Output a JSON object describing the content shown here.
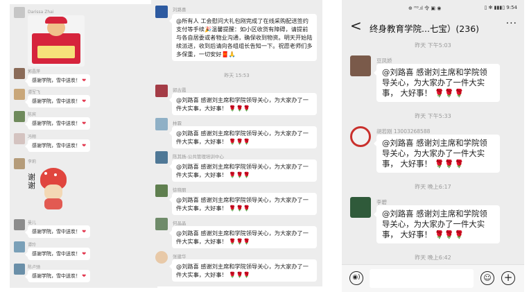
{
  "panel1": {
    "top_name": "Darissa Zhai",
    "messages": [
      {
        "name": "郭晶萍",
        "text": "感谢学院，雪中送炭！"
      },
      {
        "name": "谭军飞",
        "text": "感谢学院，雪中送炭！"
      },
      {
        "name": "陈宾",
        "text": "感谢学院，雪中送炭！"
      },
      {
        "name": "冯翔",
        "text": "感谢学院，雪中送炭！"
      },
      {
        "name": "李莉",
        "sticker": "谢谢"
      },
      {
        "name": "曼儿",
        "text": "感谢学院，雪中送炭！"
      },
      {
        "name": "谭玲",
        "text": "感谢学院，雪中送炭！"
      },
      {
        "name": "陈卢驰",
        "text": "感谢学院，雪中送炭！"
      }
    ],
    "heart": "❤"
  },
  "panel2": {
    "first": {
      "name": "刘路喜",
      "text": "@所有人 工会慰问大礼包刚完成了在线采购配送签约支付等手续🎉温馨提醒：如小区收货有障碍，请提前与各自居委或者物业沟通，确保收到物资。明天开始陆续派送，收到后请向各组组长告知一下。祝愿老师们多多保重，一切安好🧧🙏"
    },
    "timestamp": "昨天 15:53",
    "messages": [
      {
        "name": "郭古霞",
        "text": "@刘路喜 感谢刘主席和学院领导关心，为大家办了一件大实事，大好事！ 🌹🌹🌹"
      },
      {
        "name": "林霖",
        "text": "@刘路喜 感谢刘主席和学院领导关心，为大家办了一件大实事，大好事！ 🌹🌹🌹"
      },
      {
        "name": "陈其扬-公共管理培训中心",
        "text": "@刘路喜 感谢刘主席和学院领导关心，为大家办了一件大实事，大好事！ 🌹🌹🌹"
      },
      {
        "name": "徐晓丽",
        "text": "@刘路喜 感谢刘主席和学院领导关心，为大家办了一件大实事，大好事！ 🌹🌹🌹"
      },
      {
        "name": "何晶晶",
        "text": "@刘路喜 感谢刘主席和学院领导关心，为大家办了一件大实事，大好事！ 🌹🌹🌹"
      },
      {
        "name": "张建华",
        "text": "@刘路喜 感谢刘主席和学院领导关心，为大家办了一件大实事，大好事！ 🌹🌹🌹"
      }
    ]
  },
  "panel3": {
    "status_left": "⊕ ᴴᴰ.ıl 令 ▣ ◉",
    "status_right": "▯ ✻ ▮▮▮▯ 9:54",
    "back": "<",
    "title": "终身教育学院...七宝）(236)",
    "more": "···",
    "blocks": [
      {
        "time": "昨天 下午5:03",
        "name": "豆凤娇",
        "text": "@刘路喜  感谢刘主席和学院领导关心，为大家办了一件大实事，  大好事！ 🌹🌹🌹"
      },
      {
        "time": "昨天 下午5:33",
        "name": "胡若刚 13003268588",
        "text": "@刘路喜  感谢刘主席和学院领导关心，为大家办了一件大实事，  大好事！ 🌹🌹🌹"
      },
      {
        "time": "昨天 晚上6:17",
        "name": "李碧",
        "text": "@刘路喜  感谢刘主席和学院领导关心，为大家办了一件大实事，  大好事！ 🌹🌹🌹"
      }
    ],
    "last_time": "昨天 晚上6:42",
    "voice_icon": "◉)",
    "emoji_icon": "☺",
    "plus_icon": "+"
  },
  "colors": {
    "bg": "#ededed",
    "bubble": "#ffffff",
    "heart": "#e2354d"
  }
}
